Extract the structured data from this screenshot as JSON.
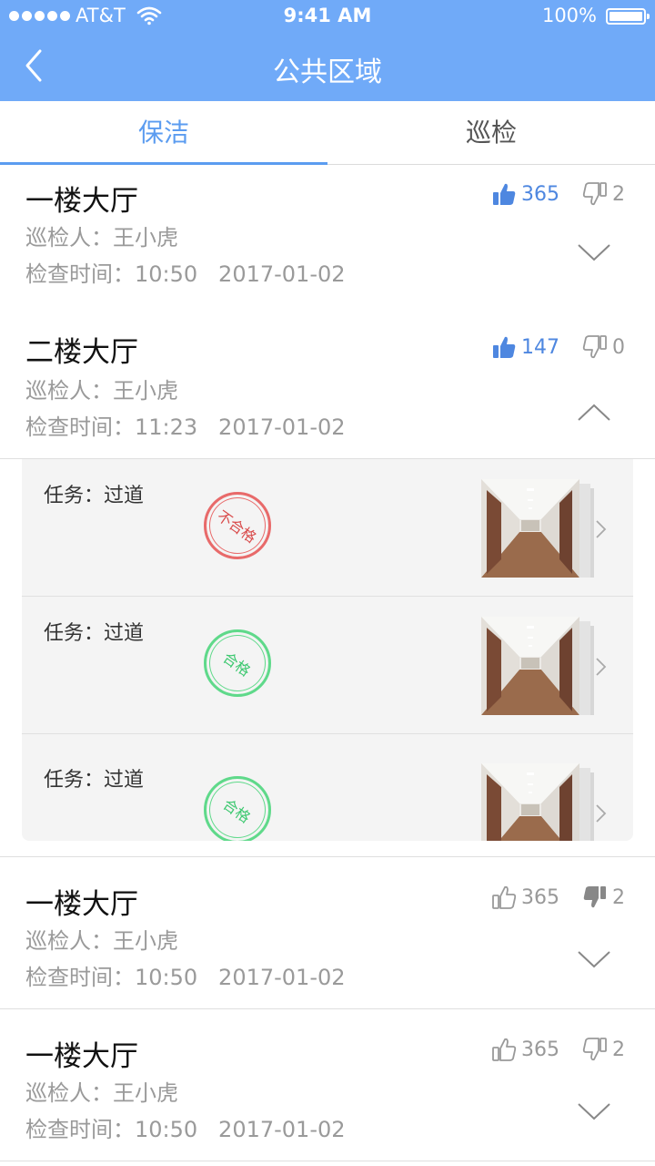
{
  "status_bar": {
    "carrier": "AT&T",
    "time": "9:41 AM",
    "battery": "100%"
  },
  "nav": {
    "title": "公共区域"
  },
  "tabs": [
    {
      "label": "保洁",
      "active": true
    },
    {
      "label": "巡检",
      "active": false
    }
  ],
  "colors": {
    "header": "#70aaf8",
    "accent": "#5b9cf0",
    "fail": "#e05555",
    "pass": "#4bd07e"
  },
  "records": [
    {
      "area": "一楼大厅",
      "inspector": "巡检人：王小虎",
      "check_time": "检查时间：10:50   2017-01-02",
      "likes": "365",
      "dislikes": "2",
      "liked": true,
      "disliked": false,
      "expanded": false
    },
    {
      "area": "二楼大厅",
      "inspector": "巡检人：王小虎",
      "check_time": "检查时间：11:23   2017-01-02",
      "likes": "147",
      "dislikes": "0",
      "liked": true,
      "disliked": false,
      "expanded": true
    },
    {
      "area": "一楼大厅",
      "inspector": "巡检人：王小虎",
      "check_time": "检查时间：10:50   2017-01-02",
      "likes": "365",
      "dislikes": "2",
      "liked": false,
      "disliked": true,
      "expanded": false
    },
    {
      "area": "一楼大厅",
      "inspector": "巡检人：王小虎",
      "check_time": "检查时间：10:50   2017-01-02",
      "likes": "365",
      "dislikes": "2",
      "liked": false,
      "disliked": false,
      "expanded": false
    }
  ],
  "tasks": [
    {
      "label": "任务：过道",
      "result": "不合格",
      "passed": false
    },
    {
      "label": "任务：过道",
      "result": "合格",
      "passed": true
    },
    {
      "label": "任务：过道",
      "result": "合格",
      "passed": true
    }
  ]
}
